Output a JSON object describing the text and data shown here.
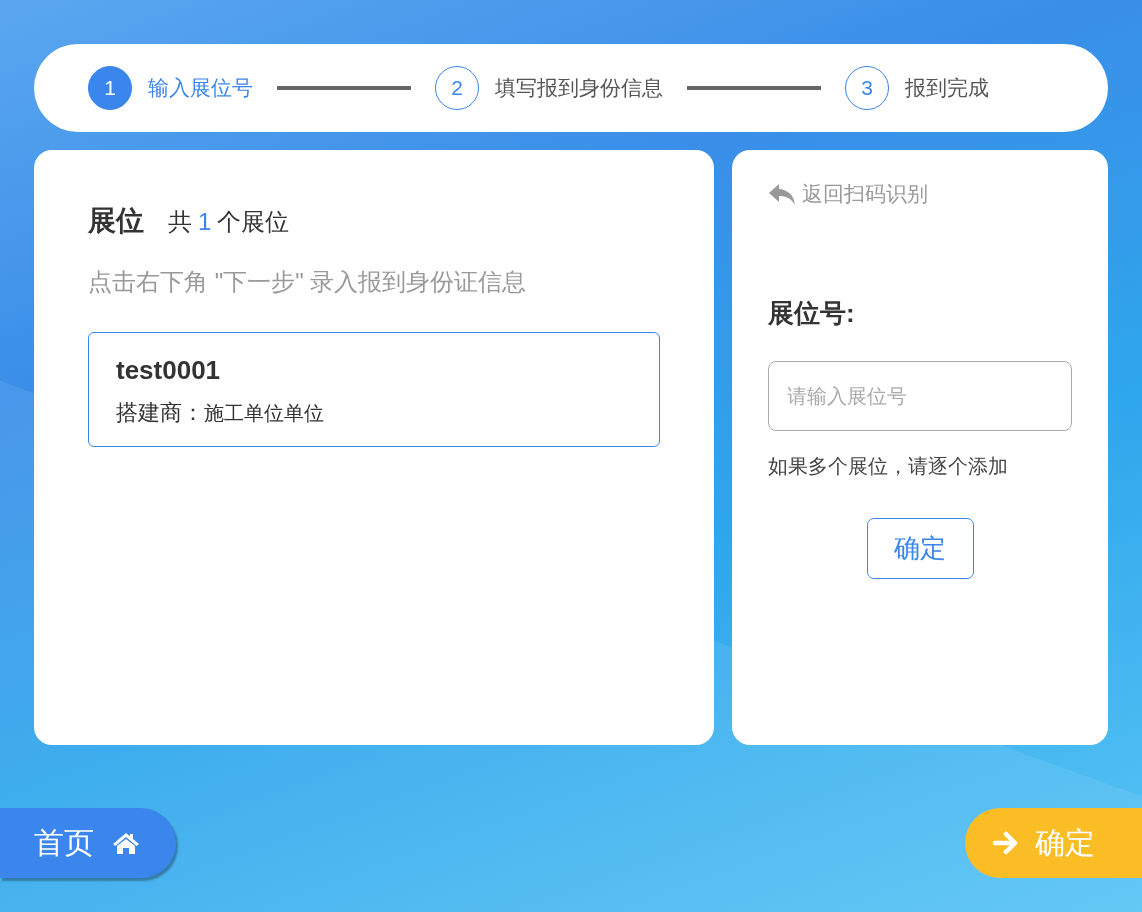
{
  "steps": [
    {
      "number": "1",
      "label": "输入展位号",
      "selected": true
    },
    {
      "number": "2",
      "label": "填写报到身份信息",
      "selected": false
    },
    {
      "number": "3",
      "label": "报到完成",
      "selected": false
    }
  ],
  "booth_panel": {
    "title": "展位",
    "count_prefix": "共",
    "count": "1",
    "count_suffix": "个展位",
    "hint": "点击右下角 \"下一步\" 录入报到身份证信息",
    "booths": [
      {
        "code": "test0001",
        "builder_label": "搭建商：",
        "builder": "施工单位单位"
      }
    ]
  },
  "entry_panel": {
    "back_link": "返回扫码识别",
    "field_label": "展位号:",
    "placeholder": "请输入展位号",
    "note": "如果多个展位，请逐个添加",
    "confirm": "确定"
  },
  "footer": {
    "home": "首页",
    "confirm": "确定"
  }
}
